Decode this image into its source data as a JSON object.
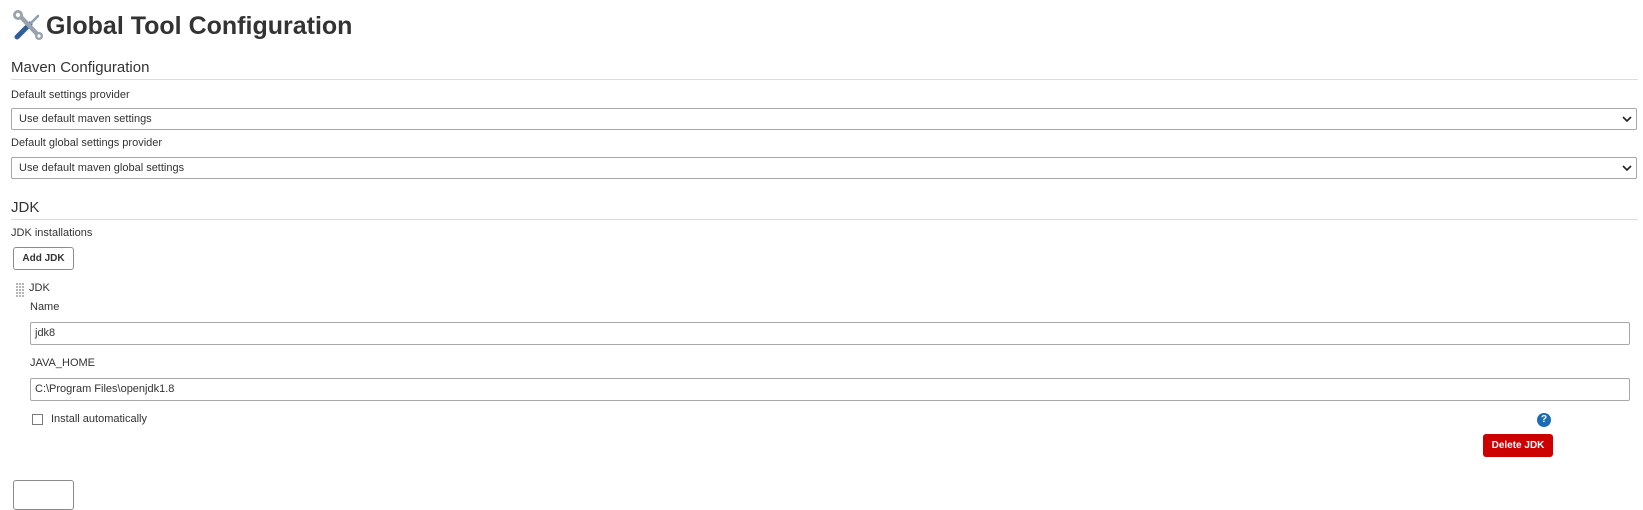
{
  "page": {
    "title": "Global Tool Configuration",
    "icon": "tools-icon"
  },
  "maven": {
    "section_title": "Maven Configuration",
    "settings_label": "Default settings provider",
    "settings_value": "Use default maven settings",
    "global_settings_label": "Default global settings provider",
    "global_settings_value": "Use default maven global settings"
  },
  "jdk": {
    "section_title": "JDK",
    "installations_label": "JDK installations",
    "add_button": "Add JDK",
    "item": {
      "title": "JDK",
      "name_label": "Name",
      "name_value": "jdk8",
      "java_home_label": "JAVA_HOME",
      "java_home_value": "C:\\Program Files\\openjdk1.8",
      "install_auto_label": "Install automatically",
      "install_auto_checked": false,
      "help": "?",
      "delete_button": "Delete JDK"
    }
  },
  "colors": {
    "delete_button": "#cc0000",
    "help_icon": "#1b6bb5"
  }
}
